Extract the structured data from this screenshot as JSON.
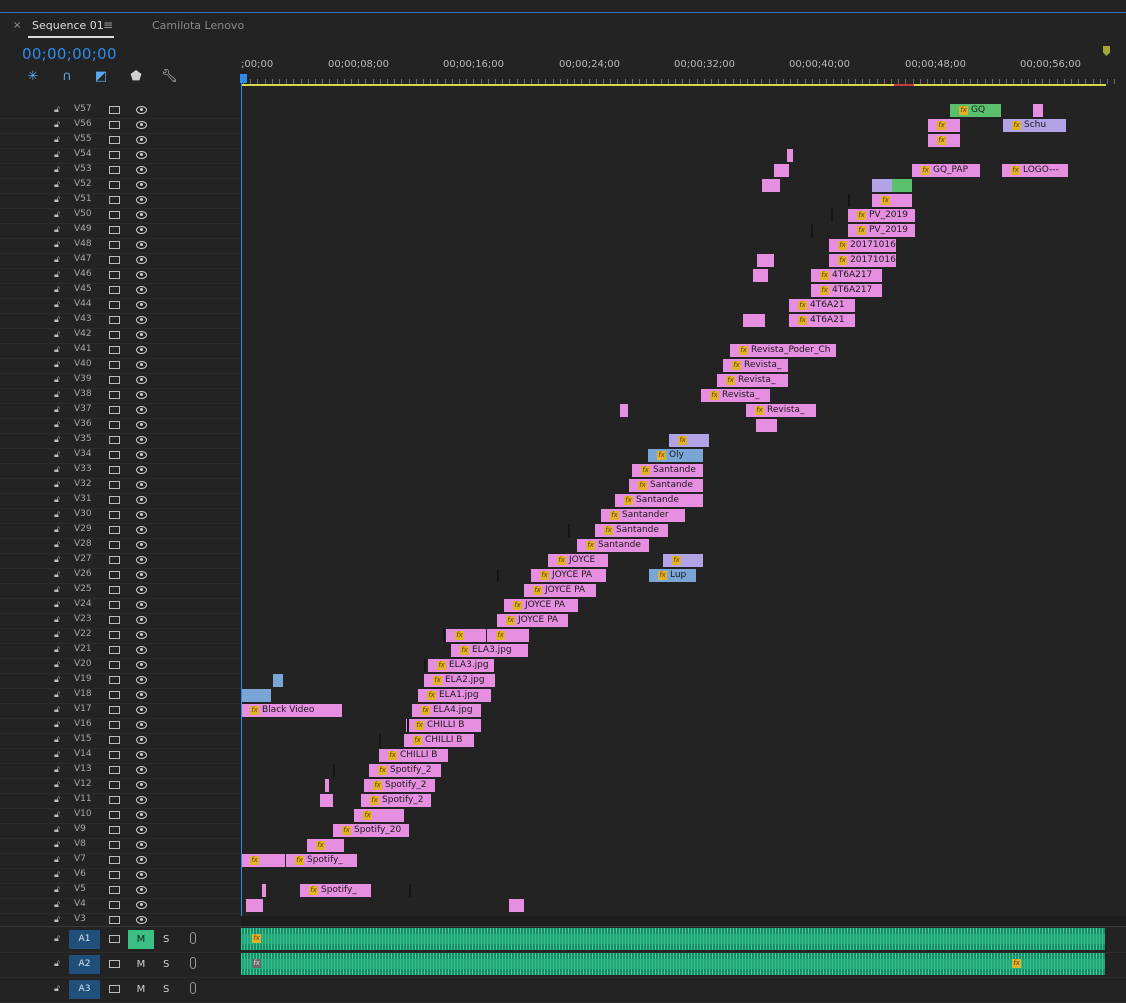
{
  "window": {
    "tab_close": "×",
    "tab_title": "Sequence 01",
    "tab_menu": "≡",
    "second_tab_title": "Camilota Lenovo"
  },
  "timecode": "00;00;00;00",
  "tools": [
    "snap-icon",
    "linked-selection-icon",
    "add-marker-icon",
    "marker-icon",
    "wrench-icon"
  ],
  "ruler": {
    "labels": [
      ";00;00",
      "00;00;08;00",
      "00;00;16;00",
      "00;00;24;00",
      "00;00;32;00",
      "00;00;40;00",
      "00;00;48;00",
      "00;00;56;00"
    ]
  },
  "video_tracks": [
    "V57",
    "V56",
    "V55",
    "V54",
    "V53",
    "V52",
    "V51",
    "V50",
    "V49",
    "V48",
    "V47",
    "V46",
    "V45",
    "V44",
    "V43",
    "V42",
    "V41",
    "V40",
    "V39",
    "V38",
    "V37",
    "V36",
    "V35",
    "V34",
    "V33",
    "V32",
    "V31",
    "V30",
    "V29",
    "V28",
    "V27",
    "V26",
    "V25",
    "V24",
    "V23",
    "V22",
    "V21",
    "V20",
    "V19",
    "V18",
    "V17",
    "V16",
    "V15",
    "V14",
    "V13",
    "V12",
    "V11",
    "V10",
    "V9",
    "V8",
    "V7",
    "V6",
    "V5",
    "V4",
    "V3",
    "V2"
  ],
  "clips": [
    {
      "track": "V57",
      "color": "green",
      "fx": true,
      "label": "GQ"
    },
    {
      "track": "V56",
      "color": "pink",
      "fx": true,
      "label": ""
    },
    {
      "track": "V56",
      "color": "lav",
      "fx": true,
      "label": "Schu"
    },
    {
      "track": "V55",
      "color": "pink",
      "fx": true,
      "label": ""
    },
    {
      "track": "V53",
      "color": "pink",
      "fx": true,
      "label": "GQ_PAP"
    },
    {
      "track": "V53",
      "color": "pink",
      "fx": true,
      "label": "LOGO---"
    },
    {
      "track": "V51",
      "color": "pink",
      "fx": true,
      "label": ""
    },
    {
      "track": "V50",
      "color": "pink",
      "fx": true,
      "label": "PV_2019"
    },
    {
      "track": "V49",
      "color": "pink",
      "fx": true,
      "label": "PV_2019"
    },
    {
      "track": "V48",
      "color": "pink",
      "fx": true,
      "label": "20171016"
    },
    {
      "track": "V47",
      "color": "pink",
      "fx": true,
      "label": "20171016"
    },
    {
      "track": "V46",
      "color": "pink",
      "fx": true,
      "label": "4T6A217"
    },
    {
      "track": "V45",
      "color": "pink",
      "fx": true,
      "label": "4T6A217"
    },
    {
      "track": "V44",
      "color": "pink",
      "fx": true,
      "label": "4T6A21"
    },
    {
      "track": "V43",
      "color": "pink",
      "fx": true,
      "label": "4T6A21"
    },
    {
      "track": "V41",
      "color": "pink",
      "fx": true,
      "label": "Revista_Poder_Ch"
    },
    {
      "track": "V40",
      "color": "pink",
      "fx": true,
      "label": "Revista_"
    },
    {
      "track": "V39",
      "color": "pink",
      "fx": true,
      "label": "Revista_"
    },
    {
      "track": "V38",
      "color": "pink",
      "fx": true,
      "label": "Revista_"
    },
    {
      "track": "V37",
      "color": "pink",
      "fx": true,
      "label": "Revista_"
    },
    {
      "track": "V35",
      "color": "lav",
      "fx": true,
      "label": ""
    },
    {
      "track": "V34",
      "color": "blue",
      "fx": true,
      "label": "Oly"
    },
    {
      "track": "V33",
      "color": "pink",
      "fx": true,
      "label": "Santande"
    },
    {
      "track": "V32",
      "color": "pink",
      "fx": true,
      "label": "Santande"
    },
    {
      "track": "V31",
      "color": "pink",
      "fx": true,
      "label": "Santande"
    },
    {
      "track": "V30",
      "color": "pink",
      "fx": true,
      "label": "Santander"
    },
    {
      "track": "V29",
      "color": "pink",
      "fx": true,
      "label": "Santande"
    },
    {
      "track": "V28",
      "color": "pink",
      "fx": true,
      "label": "Santande"
    },
    {
      "track": "V27",
      "color": "pink",
      "fx": true,
      "label": "JOYCE"
    },
    {
      "track": "V27",
      "color": "lav",
      "fx": true,
      "label": ""
    },
    {
      "track": "V26",
      "color": "pink",
      "fx": true,
      "label": "JOYCE PA"
    },
    {
      "track": "V26",
      "color": "blue",
      "fx": true,
      "label": "Lup"
    },
    {
      "track": "V25",
      "color": "pink",
      "fx": true,
      "label": "JOYCE PA"
    },
    {
      "track": "V24",
      "color": "pink",
      "fx": true,
      "label": "JOYCE PA"
    },
    {
      "track": "V23",
      "color": "pink",
      "fx": true,
      "label": "JOYCE PA"
    },
    {
      "track": "V22",
      "color": "pink",
      "fx": true,
      "label": ""
    },
    {
      "track": "V22",
      "color": "pink",
      "fx": true,
      "label": ""
    },
    {
      "track": "V21",
      "color": "pink",
      "fx": true,
      "label": "ELA3.jpg"
    },
    {
      "track": "V20",
      "color": "pink",
      "fx": true,
      "label": "ELA3.jpg"
    },
    {
      "track": "V19",
      "color": "pink",
      "fx": true,
      "label": "ELA2.jpg"
    },
    {
      "track": "V18",
      "color": "pink",
      "fx": true,
      "label": "ELA1.jpg"
    },
    {
      "track": "V17",
      "color": "pink",
      "fx": true,
      "label": "Black Video"
    },
    {
      "track": "V17",
      "color": "pink",
      "fx": true,
      "label": "ELA4.jpg"
    },
    {
      "track": "V16",
      "color": "pink",
      "fx": true,
      "label": "CHILLI B"
    },
    {
      "track": "V15",
      "color": "pink",
      "fx": true,
      "label": "CHILLI B"
    },
    {
      "track": "V14",
      "color": "pink",
      "fx": true,
      "label": "CHILLI B"
    },
    {
      "track": "V13",
      "color": "pink",
      "fx": true,
      "label": "Spotify_2"
    },
    {
      "track": "V12",
      "color": "pink",
      "fx": true,
      "label": "Spotify_2"
    },
    {
      "track": "V11",
      "color": "pink",
      "fx": true,
      "label": "Spotify_2"
    },
    {
      "track": "V10",
      "color": "pink",
      "fx": true,
      "label": ""
    },
    {
      "track": "V9",
      "color": "pink",
      "fx": true,
      "label": "Spotify_20"
    },
    {
      "track": "V8",
      "color": "pink",
      "fx": true,
      "label": ""
    },
    {
      "track": "V7",
      "color": "pink",
      "fx": true,
      "label": ""
    },
    {
      "track": "V7",
      "color": "pink",
      "fx": true,
      "label": "Spotify_"
    },
    {
      "track": "V5",
      "color": "pink",
      "fx": true,
      "label": "Spotify_"
    }
  ],
  "audio_tracks": [
    {
      "label": "A1",
      "mute": "M",
      "solo": "S",
      "mute_on": true
    },
    {
      "label": "A2",
      "mute": "M",
      "solo": "S",
      "mute_on": false
    },
    {
      "label": "A3",
      "mute": "M",
      "solo": "S",
      "mute_on": false
    }
  ],
  "colors": {
    "accent": "#2d8ceb",
    "clip_pink": "#e68fe0",
    "clip_blue": "#79a6d6",
    "clip_lavender": "#b2a2e6",
    "clip_green": "#5ac06b",
    "audio": "#35d79b",
    "work_area": "#d8d84a"
  }
}
